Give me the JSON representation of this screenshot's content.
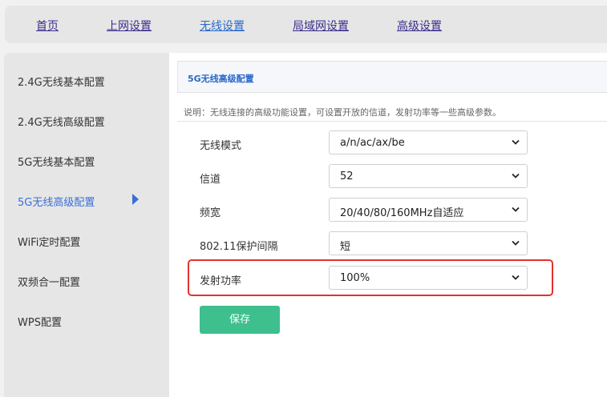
{
  "topnav": {
    "items": [
      {
        "label": "首页"
      },
      {
        "label": "上网设置"
      },
      {
        "label": "无线设置"
      },
      {
        "label": "局域网设置"
      },
      {
        "label": "高级设置"
      }
    ],
    "active_index": 2
  },
  "sidebar": {
    "items": [
      {
        "label": "2.4G无线基本配置"
      },
      {
        "label": "2.4G无线高级配置"
      },
      {
        "label": "5G无线基本配置"
      },
      {
        "label": "5G无线高级配置"
      },
      {
        "label": "WiFi定时配置"
      },
      {
        "label": "双频合一配置"
      },
      {
        "label": "WPS配置"
      }
    ],
    "active_index": 3
  },
  "main": {
    "title": "5G无线高级配置",
    "description": "说明：无线连接的高级功能设置，可设置开放的信道，发射功率等一些高级参数。",
    "fields": [
      {
        "label": "无线模式",
        "value": "a/n/ac/ax/be"
      },
      {
        "label": "信道",
        "value": "52"
      },
      {
        "label": "频宽",
        "value": "20/40/80/160MHz自适应"
      },
      {
        "label": "802.11保护间隔",
        "value": "短"
      },
      {
        "label": "发射功率",
        "value": "100%"
      }
    ],
    "save_label": "保存"
  },
  "colors": {
    "accent": "#3a6fd6",
    "save_button": "#3dbf8e",
    "highlight": "#e3312d"
  }
}
